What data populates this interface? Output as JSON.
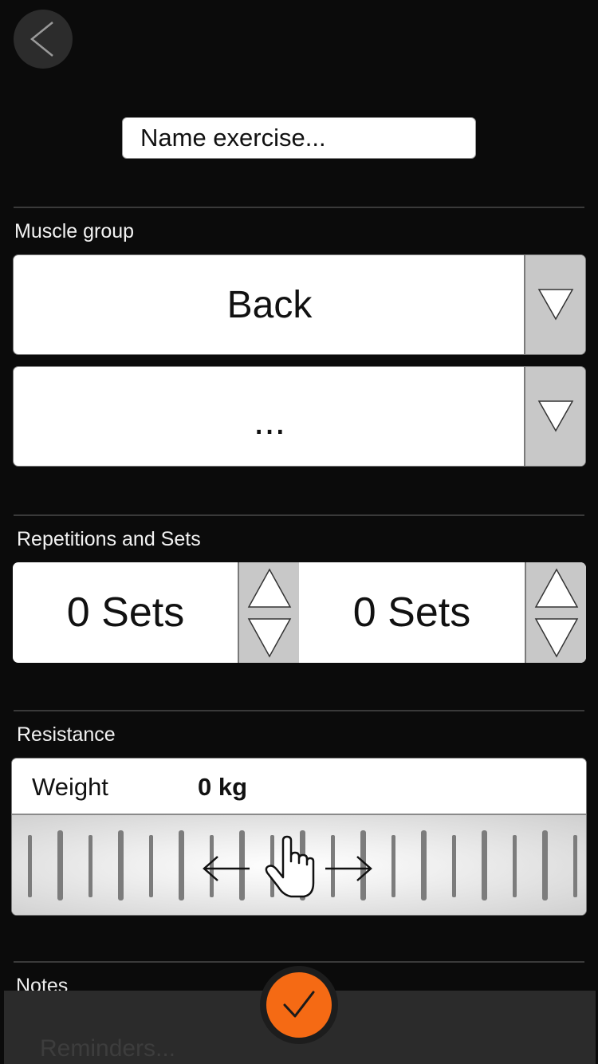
{
  "header": {
    "back_icon": "chevron-left-icon"
  },
  "name_field": {
    "placeholder": "Name exercise..."
  },
  "muscle_group": {
    "label": "Muscle group",
    "primary_value": "Back",
    "secondary_value": "...",
    "dropdown_icon": "triangle-down-icon"
  },
  "reps_sets": {
    "label": "Repetitions and Sets",
    "left_value": "0 Sets",
    "right_value": "0 Sets",
    "up_icon": "triangle-up-icon",
    "down_icon": "triangle-down-icon"
  },
  "resistance": {
    "label": "Resistance",
    "weight_label": "Weight",
    "weight_value": "0 kg",
    "slider_icons": [
      "arrow-left-icon",
      "hand-pointer-icon",
      "arrow-right-icon"
    ]
  },
  "notes": {
    "label": "Notes"
  },
  "reminders": {
    "placeholder": "Reminders..."
  },
  "confirm": {
    "icon": "checkmark-icon",
    "color": "#f56a14"
  }
}
